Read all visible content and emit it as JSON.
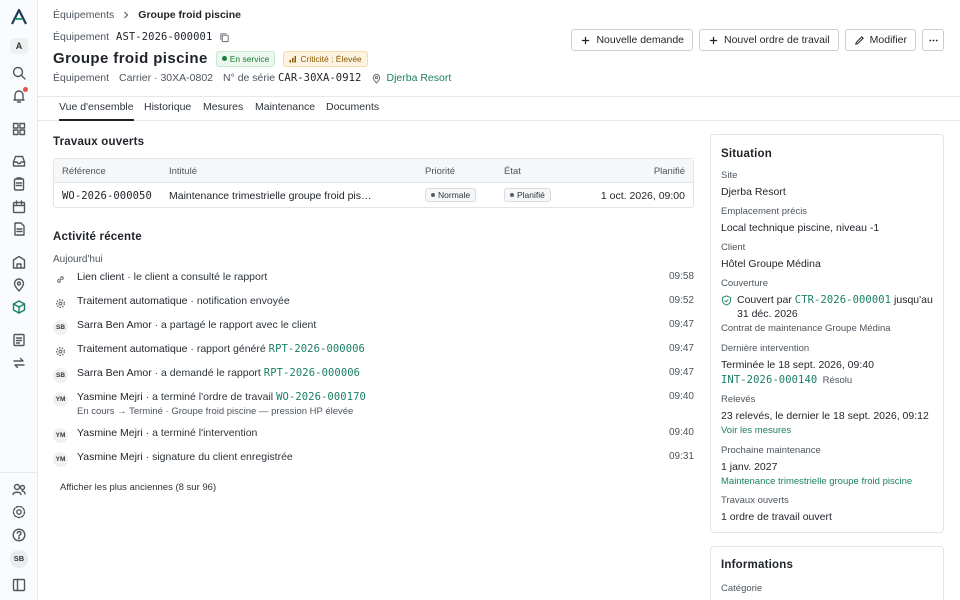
{
  "breadcrumb": {
    "parent": "Équipements",
    "current": "Groupe froid piscine"
  },
  "asset": {
    "type_label": "Équipement",
    "id": "AST-2026-000001",
    "title": "Groupe froid piscine",
    "status_badge": "En service",
    "criticality_badge": "Criticité : Élevée",
    "meta_type": "Équipement",
    "model": "Carrier · 30XA-0802",
    "serial_label": "N° de série",
    "serial": "CAR-30XA-0912",
    "location": "Djerba Resort"
  },
  "actions": {
    "new_request": "Nouvelle demande",
    "new_work_order": "Nouvel ordre de travail",
    "edit": "Modifier"
  },
  "tabs": [
    "Vue d'ensemble",
    "Historique",
    "Mesures",
    "Maintenance",
    "Documents"
  ],
  "open_work": {
    "title": "Travaux ouverts",
    "columns": {
      "ref": "Référence",
      "title": "Intitulé",
      "priority": "Priorité",
      "state": "État",
      "planned": "Planifié"
    },
    "rows": [
      {
        "ref": "WO-2026-000050",
        "title": "Maintenance trimestrielle groupe froid pis…",
        "priority": "Normale",
        "state": "Planifié",
        "planned": "1 oct. 2026, 09:00"
      }
    ]
  },
  "activity": {
    "title": "Activité récente",
    "day": "Aujourd'hui",
    "items": [
      {
        "avatar": "",
        "icon": "link-icon",
        "actor": "Lien client",
        "text": " · le client a consulté le rapport",
        "link": "",
        "time": "09:58",
        "sub": ""
      },
      {
        "avatar": "",
        "icon": "gear-icon",
        "actor": "Traitement automatique",
        "text": " · notification envoyée",
        "link": "",
        "time": "09:52",
        "sub": ""
      },
      {
        "avatar": "SB",
        "icon": "",
        "actor": "Sarra Ben Amor",
        "text": " · a partagé le rapport avec le client",
        "link": "",
        "time": "09:47",
        "sub": ""
      },
      {
        "avatar": "",
        "icon": "gear-icon",
        "actor": "Traitement automatique",
        "text": " · rapport généré ",
        "link": "RPT-2026-000006",
        "time": "09:47",
        "sub": ""
      },
      {
        "avatar": "SB",
        "icon": "",
        "actor": "Sarra Ben Amor",
        "text": " · a demandé le rapport ",
        "link": "RPT-2026-000006",
        "time": "09:47",
        "sub": ""
      },
      {
        "avatar": "YM",
        "icon": "",
        "actor": "Yasmine Mejri",
        "text": " · a terminé l'ordre de travail ",
        "link": "WO-2026-000170",
        "time": "09:40",
        "sub": "En cours → Terminé · Groupe froid piscine — pression HP élevée"
      },
      {
        "avatar": "YM",
        "icon": "",
        "actor": "Yasmine Mejri",
        "text": " · a terminé l'intervention",
        "link": "",
        "time": "09:40",
        "sub": ""
      },
      {
        "avatar": "YM",
        "icon": "",
        "actor": "Yasmine Mejri",
        "text": " · signature du client enregistrée",
        "link": "",
        "time": "09:31",
        "sub": ""
      }
    ],
    "show_older": "Afficher les plus anciennes (8 sur 96)"
  },
  "situation": {
    "title": "Situation",
    "site_label": "Site",
    "site": "Djerba Resort",
    "location_label": "Emplacement précis",
    "location": "Local technique piscine, niveau -1",
    "client_label": "Client",
    "client": "Hôtel Groupe Médina",
    "coverage_label": "Couverture",
    "coverage_prefix": "Couvert par ",
    "coverage_contract": "CTR-2026-000001",
    "coverage_suffix": " jusqu'au 31 déc. 2026",
    "coverage_sub": "Contrat de maintenance Groupe Médina",
    "last_intervention_label": "Dernière intervention",
    "last_intervention": "Terminée le 18 sept. 2026, 09:40",
    "last_intervention_ref": "INT-2026-000140",
    "last_intervention_status": "Résolu",
    "readings_label": "Relevés",
    "readings": "23 relevés, le dernier le 18 sept. 2026, 09:12",
    "readings_link": "Voir les mesures",
    "next_maintenance_label": "Prochaine maintenance",
    "next_maintenance": "1 janv. 2027",
    "next_maintenance_link": "Maintenance trimestrielle groupe froid piscine",
    "open_work_label": "Travaux ouverts",
    "open_work": "1 ordre de travail ouvert"
  },
  "informations": {
    "title": "Informations",
    "category_label": "Catégorie"
  },
  "sidebar": {
    "workspace": "A",
    "user": "SB"
  }
}
